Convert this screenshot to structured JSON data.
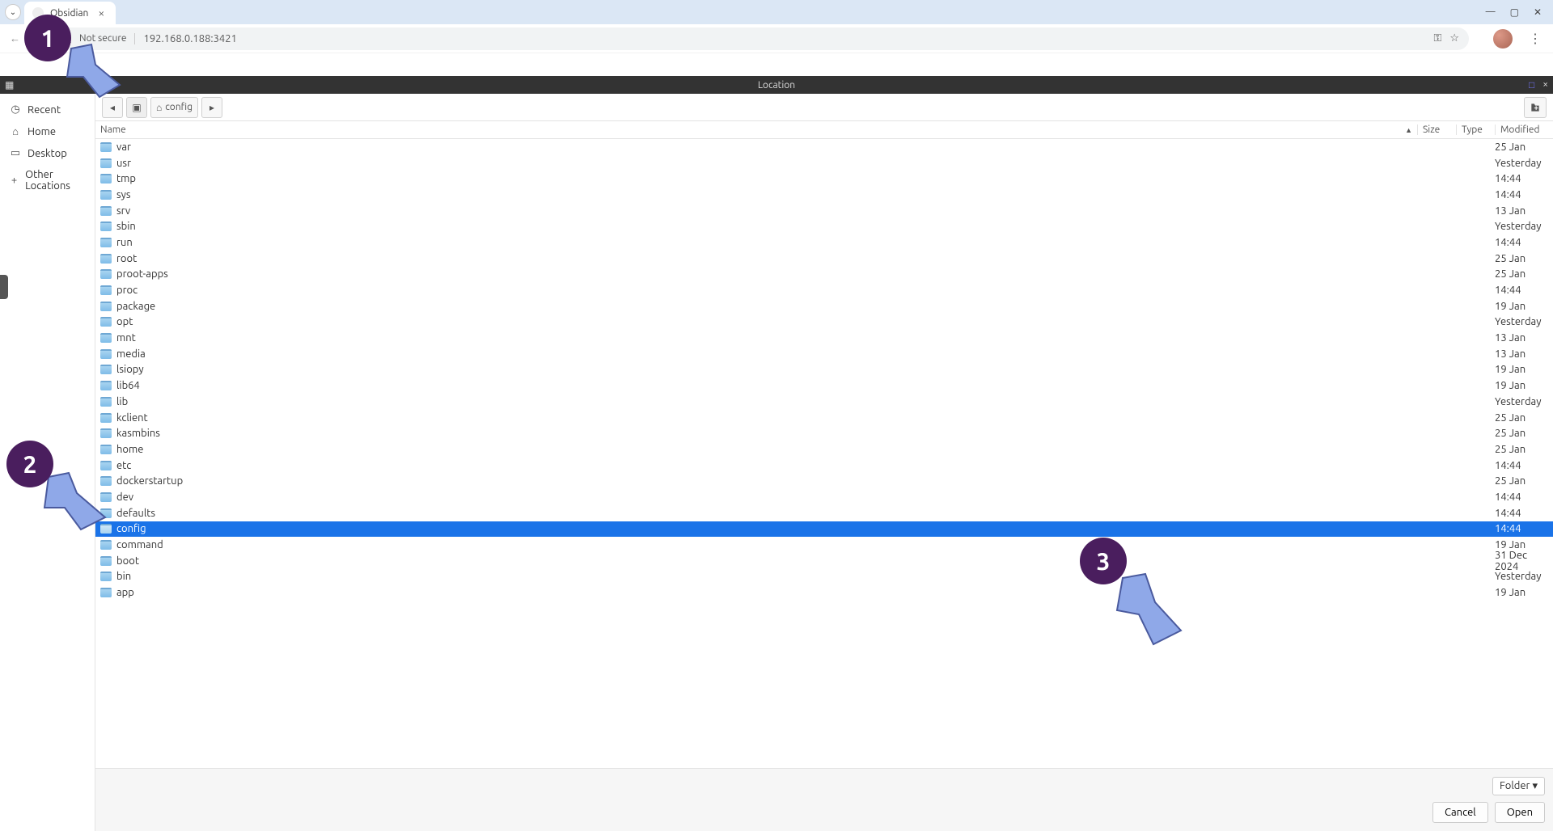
{
  "browser": {
    "tab_title": "Obsidian",
    "not_secure": "Not secure",
    "url": "192.168.0.188:3421"
  },
  "darkbar": {
    "title": "Location"
  },
  "sidebar": {
    "items": [
      {
        "icon": "◷",
        "label": "Recent"
      },
      {
        "icon": "⌂",
        "label": "Home"
      },
      {
        "icon": "▭",
        "label": "Desktop"
      },
      {
        "icon": "+",
        "label": "Other Locations"
      }
    ]
  },
  "pathbar": {
    "crumb": "config"
  },
  "columns": {
    "name": "Name",
    "size": "Size",
    "type": "Type",
    "modified": "Modified"
  },
  "files": [
    {
      "name": "var",
      "mod": "25 Jan"
    },
    {
      "name": "usr",
      "mod": "Yesterday"
    },
    {
      "name": "tmp",
      "mod": "14:44"
    },
    {
      "name": "sys",
      "mod": "14:44"
    },
    {
      "name": "srv",
      "mod": "13 Jan"
    },
    {
      "name": "sbin",
      "mod": "Yesterday"
    },
    {
      "name": "run",
      "mod": "14:44"
    },
    {
      "name": "root",
      "mod": "25 Jan"
    },
    {
      "name": "proot-apps",
      "mod": "25 Jan"
    },
    {
      "name": "proc",
      "mod": "14:44"
    },
    {
      "name": "package",
      "mod": "19 Jan"
    },
    {
      "name": "opt",
      "mod": "Yesterday"
    },
    {
      "name": "mnt",
      "mod": "13 Jan"
    },
    {
      "name": "media",
      "mod": "13 Jan"
    },
    {
      "name": "lsiopy",
      "mod": "19 Jan"
    },
    {
      "name": "lib64",
      "mod": "19 Jan"
    },
    {
      "name": "lib",
      "mod": "Yesterday"
    },
    {
      "name": "kclient",
      "mod": "25 Jan"
    },
    {
      "name": "kasmbins",
      "mod": "25 Jan"
    },
    {
      "name": "home",
      "mod": "25 Jan"
    },
    {
      "name": "etc",
      "mod": "14:44"
    },
    {
      "name": "dockerstartup",
      "mod": "25 Jan"
    },
    {
      "name": "dev",
      "mod": "14:44"
    },
    {
      "name": "defaults",
      "mod": "14:44"
    },
    {
      "name": "config",
      "mod": "14:44",
      "selected": true
    },
    {
      "name": "command",
      "mod": "19 Jan"
    },
    {
      "name": "boot",
      "mod": "31 Dec 2024"
    },
    {
      "name": "bin",
      "mod": "Yesterday"
    },
    {
      "name": "app",
      "mod": "19 Jan"
    }
  ],
  "footer": {
    "type_label": "Folder",
    "cancel": "Cancel",
    "open": "Open"
  },
  "annotations": {
    "a1": "1",
    "a2": "2",
    "a3": "3"
  }
}
